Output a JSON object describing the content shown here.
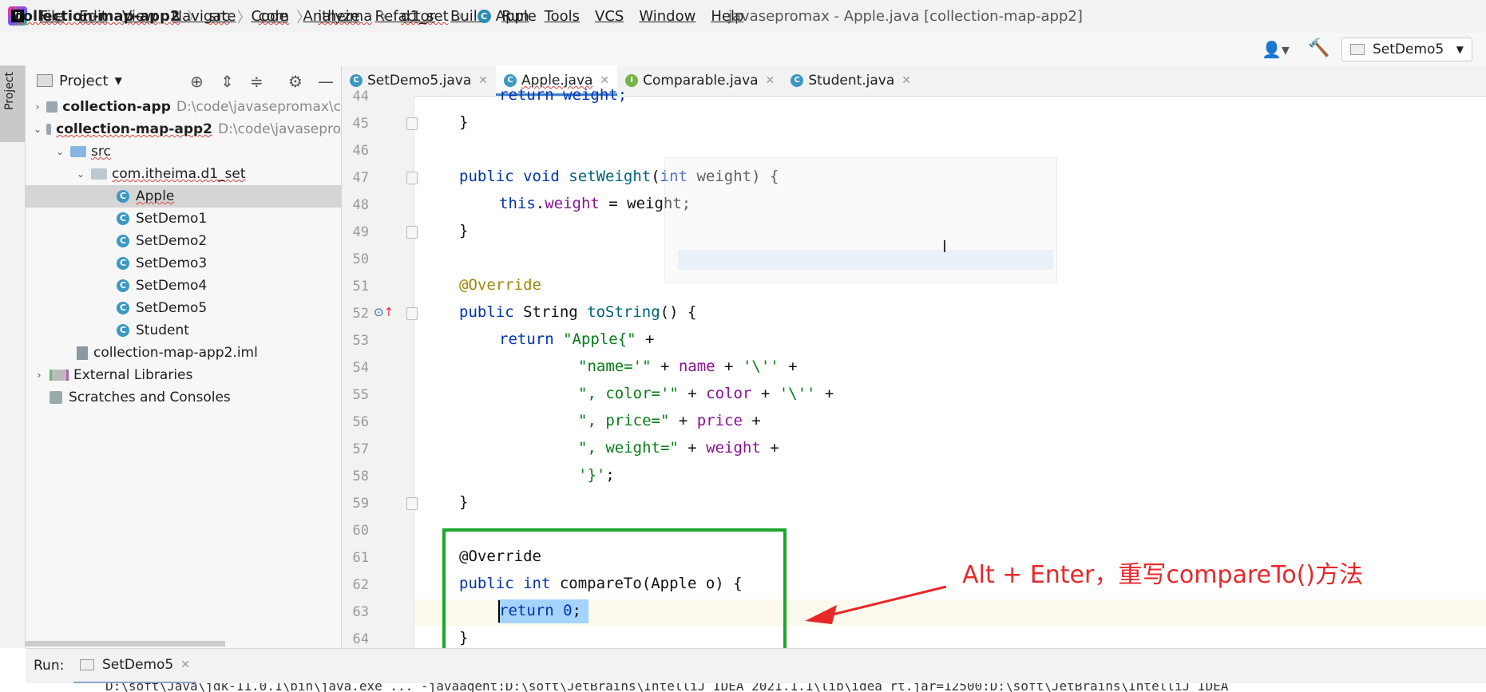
{
  "menu": {
    "items": [
      "File",
      "Edit",
      "View",
      "Navigate",
      "Code",
      "Analyze",
      "Refactor",
      "Build",
      "Run",
      "Tools",
      "VCS",
      "Window",
      "Help"
    ],
    "window_title": "javasepromax - Apple.java [collection-map-app2]"
  },
  "breadcrumb": [
    "collection-map-app2",
    "src",
    "com",
    "itheima",
    "d1_set",
    "Apple"
  ],
  "run_config": {
    "label": "SetDemo5"
  },
  "project_panel": {
    "title": "Project",
    "strip_label": "Project",
    "tree": [
      {
        "label": "collection-app",
        "path": "D:\\code\\javasepromax\\c"
      },
      {
        "label": "collection-map-app2",
        "path": "D:\\code\\javasepro"
      },
      {
        "label": "src"
      },
      {
        "label": "com.itheima.d1_set"
      },
      {
        "label": "Apple"
      },
      {
        "label": "SetDemo1"
      },
      {
        "label": "SetDemo2"
      },
      {
        "label": "SetDemo3"
      },
      {
        "label": "SetDemo4"
      },
      {
        "label": "SetDemo5"
      },
      {
        "label": "Student"
      },
      {
        "label": "collection-map-app2.iml"
      },
      {
        "label": "External Libraries"
      },
      {
        "label": "Scratches and Consoles"
      }
    ]
  },
  "tabs": [
    {
      "label": "SetDemo5.java",
      "icon": "class-run-icon"
    },
    {
      "label": "Apple.java",
      "icon": "class-icon"
    },
    {
      "label": "Comparable.java",
      "icon": "interface-icon"
    },
    {
      "label": "Student.java",
      "icon": "class-icon"
    }
  ],
  "editor": {
    "line_numbers": [
      "44",
      "45",
      "46",
      "47",
      "48",
      "49",
      "50",
      "51",
      "52",
      "53",
      "54",
      "55",
      "56",
      "57",
      "58",
      "59",
      "60",
      "61",
      "62",
      "63",
      "64"
    ],
    "code": {
      "l44": "return weight;",
      "l45": "}",
      "l47_kw": "public void ",
      "l47_fn": "setWeight",
      "l47_rest1": "(",
      "l47_kw2": "int",
      "l47_rest2": " weight) {",
      "l48_kw": "this",
      "l48_dot": ".",
      "l48_fld": "weight",
      "l48_rest": " = weight;",
      "l49": "}",
      "l51": "@Override",
      "l52_kw": "public ",
      "l52_type": "String ",
      "l52_fn": "toString",
      "l52_rest": "() {",
      "l53_kw": "return ",
      "l53_str": "\"Apple{\"",
      "l53_rest": " +",
      "l54_str": "\"name='\"",
      "l54_a": " + ",
      "l54_fld": "name",
      "l54_b": " + ",
      "l54_str2": "'\\''",
      "l54_c": " +",
      "l55_str": "\", color='\"",
      "l55_a": " + ",
      "l55_fld": "color",
      "l55_b": " + ",
      "l55_str2": "'\\''",
      "l55_c": " +",
      "l56_str": "\", price=\"",
      "l56_a": " + ",
      "l56_fld": "price",
      "l56_c": " +",
      "l57_str": "\", weight=\"",
      "l57_a": " + ",
      "l57_fld": "weight",
      "l57_c": " +",
      "l58_str": "'}'",
      "l58_c": ";",
      "l59": "}",
      "l61": "@Override",
      "l62_kw": "public ",
      "l62_kw2": "int ",
      "l62_rest": "compareTo(Apple o) {",
      "l63_kw": "return ",
      "l63_num": "0",
      "l63_c": ";",
      "l64": "}"
    }
  },
  "annotation": {
    "text": "Alt + Enter，重写compareTo()方法",
    "color": "#e8272a",
    "box_color": "#1aa72c"
  },
  "run_panel": {
    "label": "Run:",
    "tab": "SetDemo5",
    "console": "D:\\soft\\Java\\jdk-11.0.1\\bin\\java.exe ... -javaagent:D:\\soft\\JetBrains\\IntelliJ IDEA 2021.1.1\\lib\\idea_rt.jar=12500:D:\\soft\\JetBrains\\IntelliJ IDEA"
  }
}
